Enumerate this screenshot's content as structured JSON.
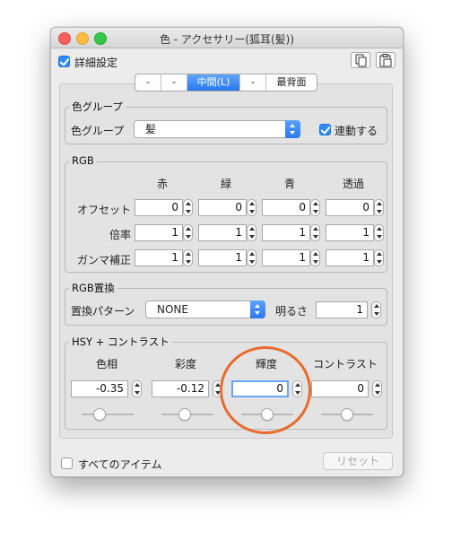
{
  "window": {
    "title": "色 - アクセサリー(狐耳(髪))"
  },
  "detail_checkbox": {
    "label": "詳細設定",
    "checked": true
  },
  "toolbar_icons": [
    "copy-icon",
    "paste-icon"
  ],
  "segments": [
    "-",
    "-",
    "中間(L)",
    "-",
    "最背面"
  ],
  "color_group": {
    "legend": "色グループ",
    "label": "色グループ",
    "value": "髪",
    "link_label": "連動する",
    "link_checked": true
  },
  "rgb": {
    "legend": "RGB",
    "headers": [
      "赤",
      "緑",
      "青",
      "透過"
    ],
    "rows": [
      {
        "label": "オフセット",
        "values": [
          "0",
          "0",
          "0",
          "0"
        ]
      },
      {
        "label": "倍率",
        "values": [
          "1",
          "1",
          "1",
          "1"
        ]
      },
      {
        "label": "ガンマ補正",
        "values": [
          "1",
          "1",
          "1",
          "1"
        ]
      }
    ]
  },
  "rgb_replace": {
    "legend": "RGB置換",
    "pattern_label": "置換パターン",
    "pattern_value": "NONE",
    "brightness_label": "明るさ",
    "brightness_value": "1"
  },
  "hsy": {
    "legend": "HSY + コントラスト",
    "headers": [
      "色相",
      "彩度",
      "輝度",
      "コントラスト"
    ],
    "values": [
      "-0.35",
      "-0.12",
      "0",
      "0"
    ],
    "slider_levels": [
      0.34,
      0.44,
      0.5,
      0.5
    ]
  },
  "all_items": {
    "label": "すべてのアイテム",
    "checked": false
  },
  "reset_label": "リセット",
  "colors": {
    "accent": "#2f8bf5",
    "highlight_ring": "#ea6a2c"
  }
}
